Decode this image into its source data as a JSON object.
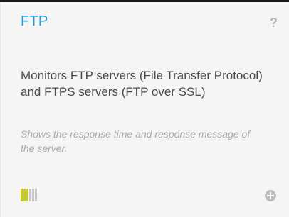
{
  "card": {
    "title": "FTP",
    "help_label": "?",
    "description": "Monitors FTP servers (File Transfer Protocol) and FTPS servers (FTP over SSL)",
    "note": "Shows the response time and response message of the server.",
    "performance_bars": {
      "filled": 3,
      "total": 6,
      "filled_color": "#c7cc1a",
      "empty_color": "#c8c8c8"
    },
    "add_icon": "plus-circle-icon"
  }
}
